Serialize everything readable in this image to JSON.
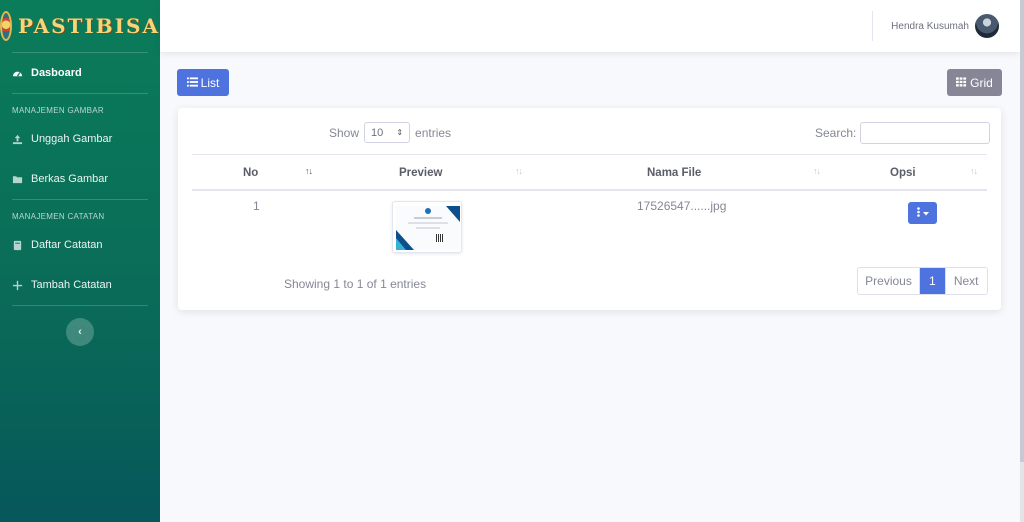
{
  "brand": {
    "name": "PASTIBISA"
  },
  "sidebar": {
    "dashboard": "Dasboard",
    "section_images": "MANAJEMEN GAMBAR",
    "upload": "Unggah Gambar",
    "files": "Berkas Gambar",
    "section_notes": "MANAJEMEN CATATAN",
    "note_list": "Daftar Catatan",
    "add_note": "Tambah Catatan",
    "toggle": "‹"
  },
  "topbar": {
    "user_name": "Hendra Kusumah"
  },
  "view": {
    "list_label": "List",
    "grid_label": "Grid"
  },
  "table": {
    "show_label": "Show",
    "entries_value": "10",
    "entries_label": "entries",
    "search_label": "Search:",
    "search_value": "",
    "columns": [
      "No",
      "Preview",
      "Nama File",
      "Opsi"
    ],
    "rows": [
      {
        "no": "1",
        "filename": "17526547......jpg"
      }
    ],
    "info": "Showing 1 to 1 of 1 entries",
    "pagination": {
      "previous": "Previous",
      "current": "1",
      "next": "Next"
    }
  },
  "colors": {
    "primary": "#4e73df",
    "secondary": "#858796",
    "sidebar": "#0b7c5a"
  },
  "icons": {
    "dashboard": "dashboard-icon",
    "upload": "upload-icon",
    "folder": "folder-icon",
    "book": "book-icon",
    "plus": "plus-icon",
    "list": "list-icon",
    "grid": "grid-icon",
    "options": "ellipsis-vertical-icon"
  }
}
